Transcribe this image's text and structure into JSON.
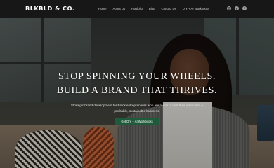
{
  "brand": {
    "logo_text": "BLKBLD & CO.",
    "accent_color": "#1f5a3b",
    "nav_background": "#161716"
  },
  "nav": {
    "items": [
      {
        "label": "Home"
      },
      {
        "label": "About Us"
      },
      {
        "label": "Portfolio"
      },
      {
        "label": "Blog"
      },
      {
        "label": "Contact Us"
      },
      {
        "label": "DIY + AI Workbooks"
      }
    ]
  },
  "social": {
    "icons": [
      "instagram-icon",
      "pinterest-icon",
      "facebook-icon"
    ]
  },
  "hero": {
    "headline_line1": "Stop spinning your wheels.",
    "headline_line2": "Build a brand that thrives.",
    "subtext_line1": "Strategic brand development for Black entrepreneurs who are ready to turn their vision into a",
    "subtext_line2": "profitable, sustainable business.",
    "cta_label": "Get DIY + AI Workbooks"
  }
}
